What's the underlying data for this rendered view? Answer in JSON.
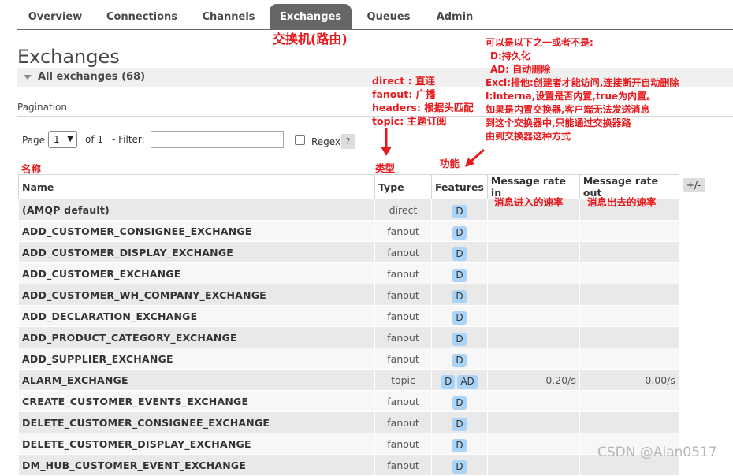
{
  "nav": {
    "tabs": [
      "Overview",
      "Connections",
      "Channels",
      "Exchanges",
      "Queues",
      "Admin"
    ],
    "active": "Exchanges"
  },
  "page_title": "Exchanges",
  "section": {
    "label": "All exchanges (68)"
  },
  "pagination": {
    "label": "Pagination",
    "page_label": "Page",
    "page_value": "1",
    "of_text": "of 1",
    "filter_label": "- Filter:",
    "filter_value": "",
    "regex_label": "Regex",
    "help": "?"
  },
  "table": {
    "columns": [
      "Name",
      "Type",
      "Features",
      "Message rate in",
      "Message rate out"
    ],
    "plus_minus": "+/-",
    "rows": [
      {
        "name": "(AMQP default)",
        "type": "direct",
        "features": [
          "D"
        ],
        "rate_in": "",
        "rate_out": ""
      },
      {
        "name": "ADD_CUSTOMER_CONSIGNEE_EXCHANGE",
        "type": "fanout",
        "features": [
          "D"
        ],
        "rate_in": "",
        "rate_out": ""
      },
      {
        "name": "ADD_CUSTOMER_DISPLAY_EXCHANGE",
        "type": "fanout",
        "features": [
          "D"
        ],
        "rate_in": "",
        "rate_out": ""
      },
      {
        "name": "ADD_CUSTOMER_EXCHANGE",
        "type": "fanout",
        "features": [
          "D"
        ],
        "rate_in": "",
        "rate_out": ""
      },
      {
        "name": "ADD_CUSTOMER_WH_COMPANY_EXCHANGE",
        "type": "fanout",
        "features": [
          "D"
        ],
        "rate_in": "",
        "rate_out": ""
      },
      {
        "name": "ADD_DECLARATION_EXCHANGE",
        "type": "fanout",
        "features": [
          "D"
        ],
        "rate_in": "",
        "rate_out": ""
      },
      {
        "name": "ADD_PRODUCT_CATEGORY_EXCHANGE",
        "type": "fanout",
        "features": [
          "D"
        ],
        "rate_in": "",
        "rate_out": ""
      },
      {
        "name": "ADD_SUPPLIER_EXCHANGE",
        "type": "fanout",
        "features": [
          "D"
        ],
        "rate_in": "",
        "rate_out": ""
      },
      {
        "name": "ALARM_EXCHANGE",
        "type": "topic",
        "features": [
          "D",
          "AD"
        ],
        "rate_in": "0.20/s",
        "rate_out": "0.00/s"
      },
      {
        "name": "CREATE_CUSTOMER_EVENTS_EXCHANGE",
        "type": "fanout",
        "features": [
          "D"
        ],
        "rate_in": "",
        "rate_out": ""
      },
      {
        "name": "DELETE_CUSTOMER_CONSIGNEE_EXCHANGE",
        "type": "fanout",
        "features": [
          "D"
        ],
        "rate_in": "",
        "rate_out": ""
      },
      {
        "name": "DELETE_CUSTOMER_DISPLAY_EXCHANGE",
        "type": "fanout",
        "features": [
          "D"
        ],
        "rate_in": "",
        "rate_out": ""
      },
      {
        "name": "DM_HUB_CUSTOMER_EVENT_EXCHANGE",
        "type": "fanout",
        "features": [
          "D"
        ],
        "rate_in": "",
        "rate_out": ""
      }
    ]
  },
  "annotations": {
    "exchange_title": "交换机(路由)",
    "type_lines": [
      "direct : 直连",
      "fanout: 广播",
      "headers: 根据头匹配",
      "topic: 主题订阅"
    ],
    "feature_lines": [
      "可以是以下之一或者不是:",
      "  D:持久化",
      "  AD: 自动删除",
      "Excl:排他:创建者才能访问,连接断开自动删除",
      "I:Interna,设置是否内置,true为内置。",
      "如果是内置交换器,客户端无法发送消息",
      "到这个交换器中,只能通过交换器路",
      "由到交换器这种方式"
    ],
    "name_label": "名称",
    "type_label": "类型",
    "features_label": "功能",
    "rate_in_note": "消息进入的速率",
    "rate_out_note": "消息出去的速率"
  },
  "colors": {
    "accent_red": "#e8191d",
    "active_tab": "#666666",
    "badge": "#aad4f7"
  },
  "watermark": "CSDN @Alan0517"
}
